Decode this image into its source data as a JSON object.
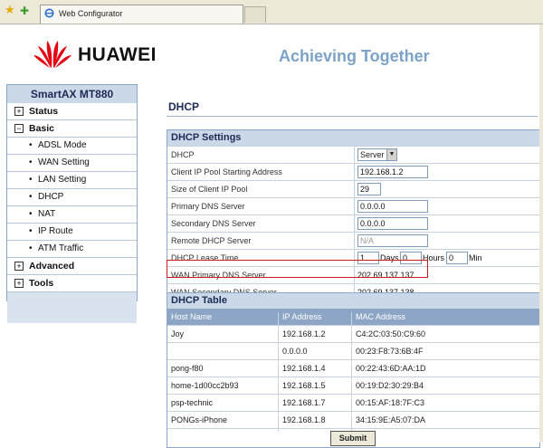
{
  "browser": {
    "tab_title": "Web Configurator"
  },
  "header": {
    "brand": "HUAWEI",
    "tagline": "Achieving Together"
  },
  "sidebar": {
    "title": "SmartAX MT880",
    "items": [
      {
        "type": "top",
        "icon": "+",
        "label": "Status"
      },
      {
        "type": "top",
        "icon": "−",
        "label": "Basic"
      },
      {
        "type": "sub",
        "label": "ADSL Mode"
      },
      {
        "type": "sub",
        "label": "WAN Setting"
      },
      {
        "type": "sub",
        "label": "LAN Setting"
      },
      {
        "type": "sub",
        "label": "DHCP"
      },
      {
        "type": "sub",
        "label": "NAT"
      },
      {
        "type": "sub",
        "label": "IP Route"
      },
      {
        "type": "sub",
        "label": "ATM Traffic"
      },
      {
        "type": "top",
        "icon": "+",
        "label": "Advanced"
      },
      {
        "type": "top",
        "icon": "+",
        "label": "Tools"
      }
    ]
  },
  "page": {
    "title": "DHCP"
  },
  "settings": {
    "heading": "DHCP Settings",
    "dhcp_label": "DHCP",
    "dhcp_value": "Server",
    "pool_start_label": "Client IP Pool Starting Address",
    "pool_start_value": "192.168.1.2",
    "pool_size_label": "Size of Client IP Pool",
    "pool_size_value": "29",
    "primary_dns_label": "Primary DNS Server",
    "primary_dns_value": "0.0.0.0",
    "secondary_dns_label": "Secondary DNS Server",
    "secondary_dns_value": "0.0.0.0",
    "remote_dhcp_label": "Remote DHCP Server",
    "remote_dhcp_value": "N/A",
    "lease_label": "DHCP Lease Time",
    "lease_days": "1",
    "lease_days_unit": "Days",
    "lease_hours": "0",
    "lease_hours_unit": "Hours",
    "lease_min": "0",
    "lease_min_unit": "Min",
    "wan_primary_label": "WAN Primary DNS Server",
    "wan_primary_value": "202.69.137.137",
    "wan_secondary_label": "WAN Secondary DNS Server",
    "wan_secondary_value": "202.69.137.138"
  },
  "table": {
    "heading": "DHCP Table",
    "columns": [
      "Host Name",
      "IP Address",
      "MAC Address"
    ],
    "rows": [
      [
        "Joy",
        "192.168.1.2",
        "C4:2C:03:50:C9:60"
      ],
      [
        "",
        "0.0.0.0",
        "00:23:F8:73:6B:4F"
      ],
      [
        "pong-f80",
        "192.168.1.4",
        "00:22:43:6D:AA:1D"
      ],
      [
        "home-1d00cc2b93",
        "192.168.1.5",
        "00:19:D2:30:29:B4"
      ],
      [
        "psp-technic",
        "192.168.1.7",
        "00:15:AF:18:7F:C3"
      ],
      [
        "PONGs-iPhone",
        "192.168.1.8",
        "34:15:9E:A5:07:DA"
      ]
    ]
  },
  "actions": {
    "submit_label": "Submit"
  }
}
